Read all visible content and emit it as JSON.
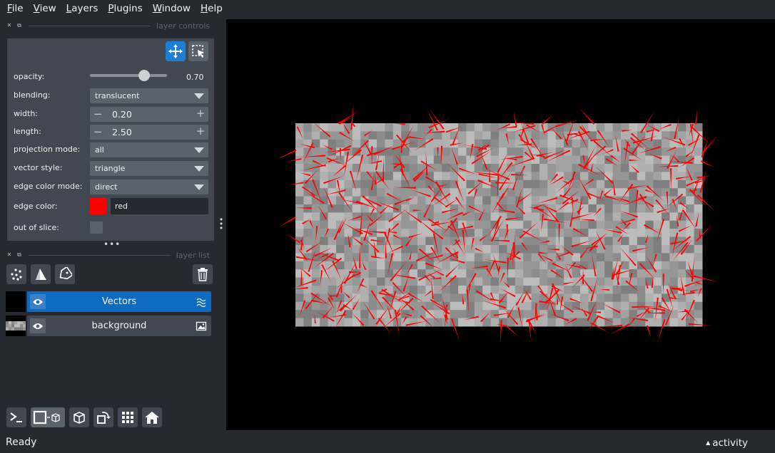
{
  "menu": {
    "file": {
      "u": "F",
      "rest": "ile"
    },
    "view": {
      "u": "V",
      "rest": "iew"
    },
    "layers": {
      "u": "L",
      "rest": "ayers"
    },
    "plugins": {
      "u": "P",
      "rest": "lugins"
    },
    "window": {
      "u": "W",
      "rest": "indow"
    },
    "help": {
      "u": "H",
      "rest": "elp"
    }
  },
  "layer_controls": {
    "title": "layer controls",
    "opacity_label": "opacity:",
    "opacity_value": "0.70",
    "opacity_fraction": 0.7,
    "blending_label": "blending:",
    "blending_value": "translucent",
    "width_label": "width:",
    "width_value": "0.20",
    "length_label": "length:",
    "length_value": "2.50",
    "projection_label": "projection mode:",
    "projection_value": "all",
    "vector_style_label": "vector style:",
    "vector_style_value": "triangle",
    "edge_color_mode_label": "edge color mode:",
    "edge_color_mode_value": "direct",
    "edge_color_label": "edge color:",
    "edge_color_value": "red",
    "edge_color_hex": "#ff0000",
    "out_of_slice_label": "out of slice:",
    "out_of_slice_checked": false
  },
  "layer_list": {
    "title": "layer list",
    "layers": [
      {
        "name": "Vectors",
        "type": "vectors",
        "visible": true,
        "selected": true
      },
      {
        "name": "background",
        "type": "image",
        "visible": true,
        "selected": false
      }
    ]
  },
  "status": {
    "text": "Ready",
    "activity": "activity"
  },
  "colors": {
    "selected_layer": "#0f6bbf",
    "accent_button": "#1c7ed6",
    "vector_color": "#ff0000"
  }
}
